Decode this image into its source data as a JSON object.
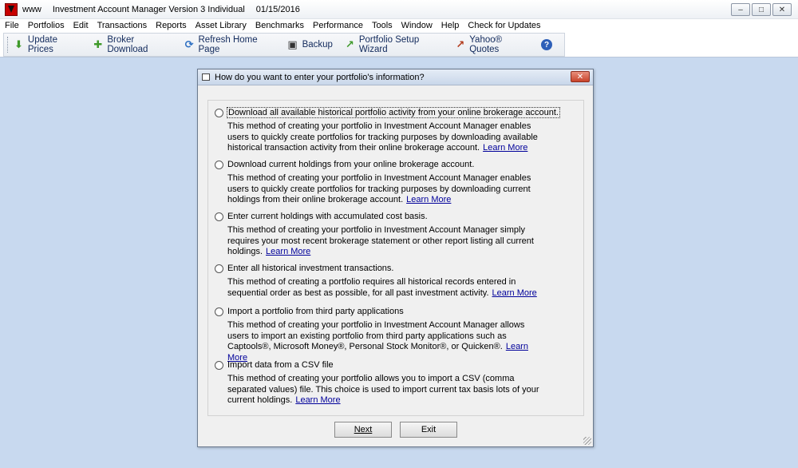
{
  "window": {
    "prefix": "www",
    "app_title": "Investment Account Manager Version 3 Individual",
    "date": "01/15/2016",
    "controls": [
      "–",
      "□",
      "✕"
    ]
  },
  "menu": [
    "File",
    "Portfolios",
    "Edit",
    "Transactions",
    "Reports",
    "Asset Library",
    "Benchmarks",
    "Performance",
    "Tools",
    "Window",
    "Help",
    "Check for Updates"
  ],
  "toolbar": {
    "update_prices": "Update Prices",
    "broker_download": "Broker Download",
    "refresh_home": "Refresh Home Page",
    "backup": "Backup",
    "setup_wizard": "Portfolio Setup Wizard",
    "yahoo_quotes": "Yahoo® Quotes",
    "help_glyph": "?",
    "icons": {
      "update_prices": "⬇",
      "broker_download": "✚",
      "refresh_home": "⟳",
      "backup": "▣",
      "setup_wizard": "↗",
      "yahoo_quotes": "↗"
    }
  },
  "dialog": {
    "title": "How do you want to enter your portfolio's information?",
    "close": "✕",
    "learn_more": "Learn More",
    "options": [
      {
        "label": "Download all available historical portfolio activity from your online brokerage account.",
        "desc": "This method of creating your portfolio in Investment Account Manager enables users to quickly create portfolios for tracking purposes by downloading available historical transaction activity from their online brokerage account."
      },
      {
        "label": "Download current holdings from your online brokerage account.",
        "desc": "This method of creating your portfolio in Investment Account Manager enables users to quickly create portfolios for tracking purposes by downloading current holdings from their online brokerage account."
      },
      {
        "label": "Enter current holdings with accumulated cost basis.",
        "desc": "This method of creating your portfolio in Investment Account Manager simply requires your most recent brokerage statement or other report listing all current holdings."
      },
      {
        "label": "Enter all historical investment transactions.",
        "desc": "This method of creating a portfolio requires all historical records entered in sequential order as best as possible, for all past investment activity."
      },
      {
        "label": "Import a portfolio from third party applications",
        "desc": "This method of creating your portfolio in Investment Account Manager allows users to import an existing portfolio from third party applications such as Captools®, Microsoft Money®, Personal Stock Monitor®, or Quicken®."
      },
      {
        "label": "Import data from a CSV file",
        "desc": "This method of creating your portfolio allows you to import a CSV (comma separated values) file.  This choice is used to import current tax basis lots of your current holdings."
      }
    ],
    "next": "Next",
    "exit": "Exit"
  }
}
